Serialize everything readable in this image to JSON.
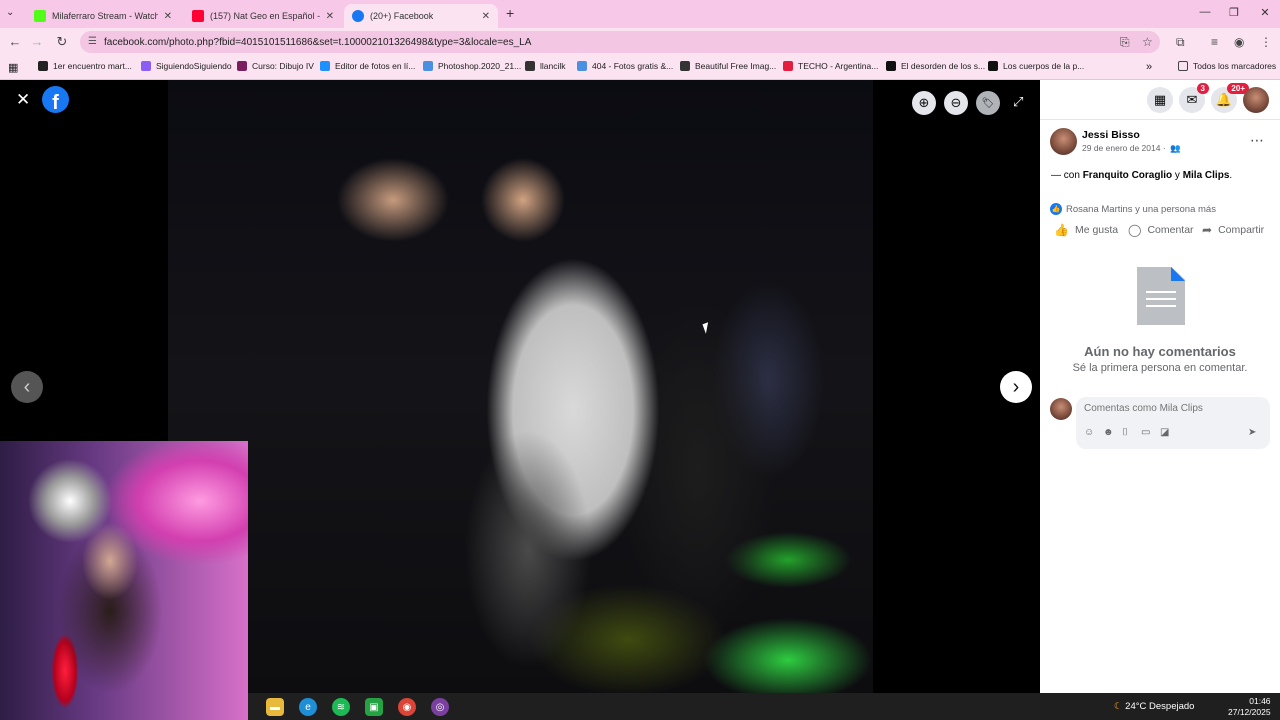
{
  "tabs": [
    {
      "label": "Milaferraro Stream - Watch Liv",
      "favicon_color": "#53fc18",
      "active": false
    },
    {
      "label": "(157) Nat Geo en Español - You",
      "favicon_color": "#ff0033",
      "active": false
    },
    {
      "label": "(20+) Facebook",
      "favicon_color": "#1877f2",
      "active": true
    }
  ],
  "new_tab_label": "+",
  "window_controls": {
    "minimize": "—",
    "restore": "❐",
    "close": "✕"
  },
  "address_bar": {
    "url": "facebook.com/photo.php?fbid=4015101511686&set=t.100002101326498&type=3&locale=es_LA"
  },
  "bookmarks": [
    {
      "label": "1er encuentro mart...",
      "icon_color": "#222"
    },
    {
      "label": "SiguiendoSiguiendo",
      "icon_color": "#8b5cf6"
    },
    {
      "label": "Curso: Dibujo IV",
      "icon_color": "#7a1e5f"
    },
    {
      "label": "Editor de fotos en lí...",
      "icon_color": "#1e90ff"
    },
    {
      "label": "Photoshop.2020_21...",
      "icon_color": "#4a90e2"
    },
    {
      "label": "llancilk",
      "icon_color": "#333"
    },
    {
      "label": "404 - Fotos gratis &...",
      "icon_color": "#4a90e2"
    },
    {
      "label": "Beautiful Free Imag...",
      "icon_color": "#333"
    },
    {
      "label": "TECHO - Argentina...",
      "icon_color": "#e41e3f"
    },
    {
      "label": "El desorden de los s...",
      "icon_color": "#111"
    },
    {
      "label": "Los cuerpos de la p...",
      "icon_color": "#111"
    }
  ],
  "all_bookmarks_label": "Todos los marcadores",
  "viewer": {
    "close_icon": "✕",
    "fb_logo_letter": "f",
    "zoom_in": "⊕",
    "zoom_out": "⊖",
    "tag": "🏷",
    "fullscreen": "⤢",
    "prev": "‹",
    "next": "›"
  },
  "fb_top": {
    "messenger_badge": "3",
    "notifications_badge": "20+"
  },
  "post": {
    "author": "Jessi Bisso",
    "date": "29 de enero de 2014 ·",
    "with_prefix": "— con",
    "with_user1": "Franquito Coraglio",
    "with_and": "y",
    "with_user2": "Mila Clips",
    "with_suffix": ".",
    "reactions": "Rosana Martins y una persona más",
    "actions": {
      "like": "Me gusta",
      "comment": "Comentar",
      "share": "Compartir"
    },
    "no_comments_title": "Aún no hay comentarios",
    "no_comments_sub": "Sé la primera persona en comentar.",
    "comment_placeholder": "Comentas como Mila Clips"
  },
  "taskbar": {
    "weather": "24°C  Despejado",
    "time": "01:46",
    "date": "27/12/2025"
  }
}
